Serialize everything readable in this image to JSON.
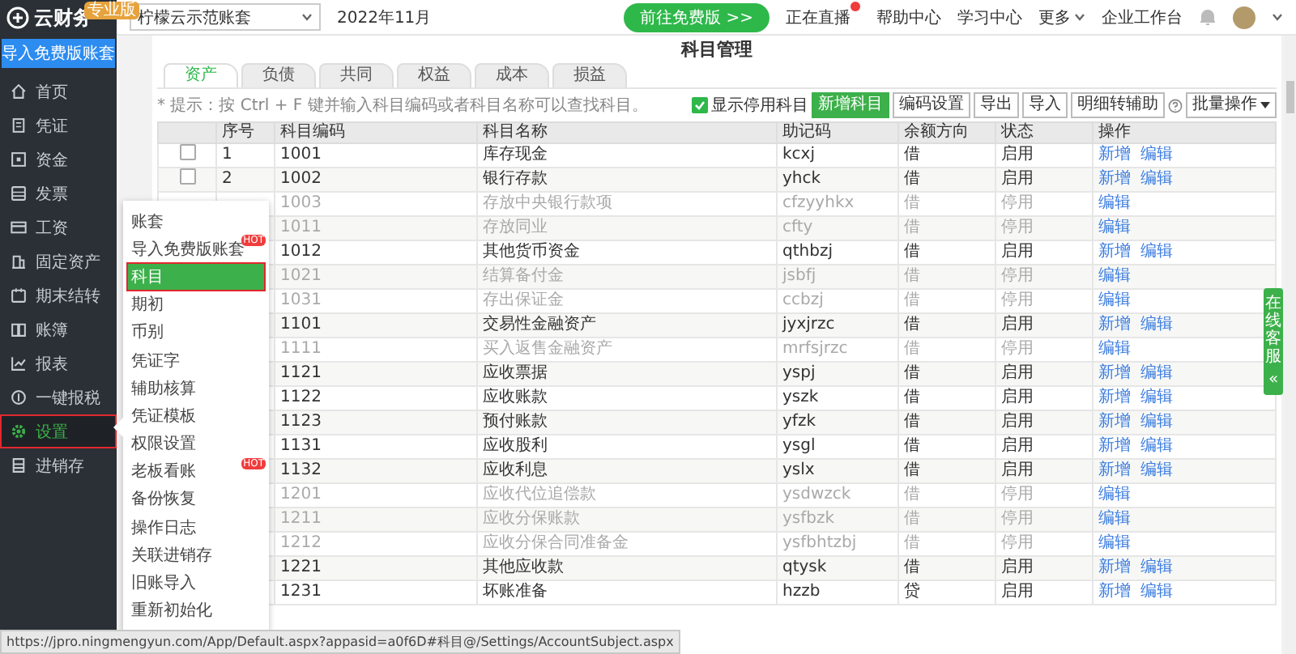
{
  "sidebar": {
    "logo": "云财务",
    "badge": "专业版",
    "import_button": "导入免费版账套",
    "items": [
      {
        "label": "首页",
        "selected": false,
        "annotated": false
      },
      {
        "label": "凭证",
        "selected": false,
        "annotated": false
      },
      {
        "label": "资金",
        "selected": false,
        "annotated": false
      },
      {
        "label": "发票",
        "selected": false,
        "annotated": false
      },
      {
        "label": "工资",
        "selected": false,
        "annotated": false
      },
      {
        "label": "固定资产",
        "selected": false,
        "annotated": false
      },
      {
        "label": "期末结转",
        "selected": false,
        "annotated": false
      },
      {
        "label": "账簿",
        "selected": false,
        "annotated": false
      },
      {
        "label": "报表",
        "selected": false,
        "annotated": false
      },
      {
        "label": "一键报税",
        "selected": false,
        "annotated": false
      },
      {
        "label": "设置",
        "selected": true,
        "annotated": true
      },
      {
        "label": "进销存",
        "selected": false,
        "annotated": false
      }
    ]
  },
  "topbar": {
    "account_select": "柠檬云示范账套",
    "period": "2022年11月",
    "upgrade_button": "前往免费版 >>",
    "links": [
      {
        "label": "正在直播",
        "hot": true,
        "dropdown": false
      },
      {
        "label": "帮助中心",
        "hot": false,
        "dropdown": false
      },
      {
        "label": "学习中心",
        "hot": false,
        "dropdown": false
      },
      {
        "label": "更多",
        "hot": false,
        "dropdown": true
      },
      {
        "label": "企业工作台",
        "hot": false,
        "dropdown": false
      }
    ]
  },
  "page": {
    "title": "科目管理",
    "tabs": [
      {
        "label": "资产",
        "selected": true
      },
      {
        "label": "负债",
        "selected": false
      },
      {
        "label": "共同",
        "selected": false
      },
      {
        "label": "权益",
        "selected": false
      },
      {
        "label": "成本",
        "selected": false
      },
      {
        "label": "损益",
        "selected": false
      }
    ],
    "hint": "* 提示：按 Ctrl + F 键并输入科目编码或者科目名称可以查找科目。",
    "show_disabled": {
      "label": "显示停用科目",
      "checked": true
    },
    "buttons": [
      {
        "label": "新增科目",
        "primary": true
      },
      {
        "label": "编码设置",
        "primary": false
      },
      {
        "label": "导出",
        "primary": false
      },
      {
        "label": "导入",
        "primary": false
      },
      {
        "label": "明细转辅助",
        "primary": false
      }
    ],
    "batch_button": "批量操作"
  },
  "table": {
    "columns": [
      "序号",
      "科目编码",
      "科目名称",
      "助记码",
      "余额方向",
      "状态",
      "操作"
    ],
    "rows": [
      {
        "checked": false,
        "seq": "1",
        "code": "1001",
        "name": "库存现金",
        "mnemonic": "kcxj",
        "direction": "借",
        "status": "启用",
        "enabled": true,
        "actions": [
          "新增",
          "编辑"
        ]
      },
      {
        "checked": false,
        "seq": "2",
        "code": "1002",
        "name": "银行存款",
        "mnemonic": "yhck",
        "direction": "借",
        "status": "启用",
        "enabled": true,
        "actions": [
          "新增",
          "编辑"
        ]
      },
      {
        "code": "1003",
        "name": "存放中央银行款项",
        "mnemonic": "cfzyyhkx",
        "direction": "借",
        "status": "停用",
        "enabled": false,
        "actions": [
          "编辑"
        ]
      },
      {
        "code": "1011",
        "name": "存放同业",
        "mnemonic": "cfty",
        "direction": "借",
        "status": "停用",
        "enabled": false,
        "actions": [
          "编辑"
        ]
      },
      {
        "code": "1012",
        "name": "其他货币资金",
        "mnemonic": "qthbzj",
        "direction": "借",
        "status": "启用",
        "enabled": true,
        "actions": [
          "新增",
          "编辑"
        ]
      },
      {
        "code": "1021",
        "name": "结算备付金",
        "mnemonic": "jsbfj",
        "direction": "借",
        "status": "停用",
        "enabled": false,
        "actions": [
          "编辑"
        ]
      },
      {
        "code": "1031",
        "name": "存出保证金",
        "mnemonic": "ccbzj",
        "direction": "借",
        "status": "停用",
        "enabled": false,
        "actions": [
          "编辑"
        ]
      },
      {
        "code": "1101",
        "name": "交易性金融资产",
        "mnemonic": "jyxjrzc",
        "direction": "借",
        "status": "启用",
        "enabled": true,
        "actions": [
          "新增",
          "编辑"
        ]
      },
      {
        "code": "1111",
        "name": "买入返售金融资产",
        "mnemonic": "mrfsjrzc",
        "direction": "借",
        "status": "停用",
        "enabled": false,
        "actions": [
          "编辑"
        ]
      },
      {
        "code": "1121",
        "name": "应收票据",
        "mnemonic": "yspj",
        "direction": "借",
        "status": "启用",
        "enabled": true,
        "actions": [
          "新增",
          "编辑"
        ]
      },
      {
        "code": "1122",
        "name": "应收账款",
        "mnemonic": "yszk",
        "direction": "借",
        "status": "启用",
        "enabled": true,
        "actions": [
          "新增",
          "编辑"
        ]
      },
      {
        "code": "1123",
        "name": "预付账款",
        "mnemonic": "yfzk",
        "direction": "借",
        "status": "启用",
        "enabled": true,
        "actions": [
          "新增",
          "编辑"
        ]
      },
      {
        "code": "1131",
        "name": "应收股利",
        "mnemonic": "ysgl",
        "direction": "借",
        "status": "启用",
        "enabled": true,
        "actions": [
          "新增",
          "编辑"
        ]
      },
      {
        "code": "1132",
        "name": "应收利息",
        "mnemonic": "yslx",
        "direction": "借",
        "status": "启用",
        "enabled": true,
        "actions": [
          "新增",
          "编辑"
        ]
      },
      {
        "code": "1201",
        "name": "应收代位追偿款",
        "mnemonic": "ysdwzck",
        "direction": "借",
        "status": "停用",
        "enabled": false,
        "actions": [
          "编辑"
        ]
      },
      {
        "code": "1211",
        "name": "应收分保账款",
        "mnemonic": "ysfbzk",
        "direction": "借",
        "status": "停用",
        "enabled": false,
        "actions": [
          "编辑"
        ]
      },
      {
        "code": "1212",
        "name": "应收分保合同准备金",
        "mnemonic": "ysfbhtzbj",
        "direction": "借",
        "status": "停用",
        "enabled": false,
        "actions": [
          "编辑"
        ]
      },
      {
        "code": "1221",
        "name": "其他应收款",
        "mnemonic": "qtysk",
        "direction": "借",
        "status": "启用",
        "enabled": true,
        "actions": [
          "新增",
          "编辑"
        ]
      },
      {
        "code": "1231",
        "name": "坏账准备",
        "mnemonic": "hzzb",
        "direction": "贷",
        "status": "启用",
        "enabled": true,
        "actions": [
          "新增",
          "编辑"
        ]
      }
    ]
  },
  "submenu": {
    "items": [
      {
        "label": "账套",
        "selected": false,
        "annotated": false
      },
      {
        "label": "导入免费版账套",
        "selected": false,
        "annotated": false,
        "badge": "HOT"
      },
      {
        "label": "科目",
        "selected": true,
        "annotated": true
      },
      {
        "label": "期初",
        "selected": false,
        "annotated": false
      },
      {
        "label": "币别",
        "selected": false,
        "annotated": false
      },
      {
        "label": "凭证字",
        "selected": false,
        "annotated": false
      },
      {
        "label": "辅助核算",
        "selected": false,
        "annotated": false
      },
      {
        "label": "凭证模板",
        "selected": false,
        "annotated": false
      },
      {
        "label": "权限设置",
        "selected": false,
        "annotated": false
      },
      {
        "label": "老板看账",
        "selected": false,
        "annotated": false,
        "badge": "HOT"
      },
      {
        "label": "备份恢复",
        "selected": false,
        "annotated": false
      },
      {
        "label": "操作日志",
        "selected": false,
        "annotated": false
      },
      {
        "label": "关联进销存",
        "selected": false,
        "annotated": false
      },
      {
        "label": "旧账导入",
        "selected": false,
        "annotated": false
      },
      {
        "label": "重新初始化",
        "selected": false,
        "annotated": false
      }
    ]
  },
  "support_tab": {
    "label": "在线客服",
    "collapse": "«"
  },
  "status_url": "https://jpro.ningmengyun.com/App/Default.aspx?appasid=a0f6D#科目@/Settings/AccountSubject.aspx"
}
